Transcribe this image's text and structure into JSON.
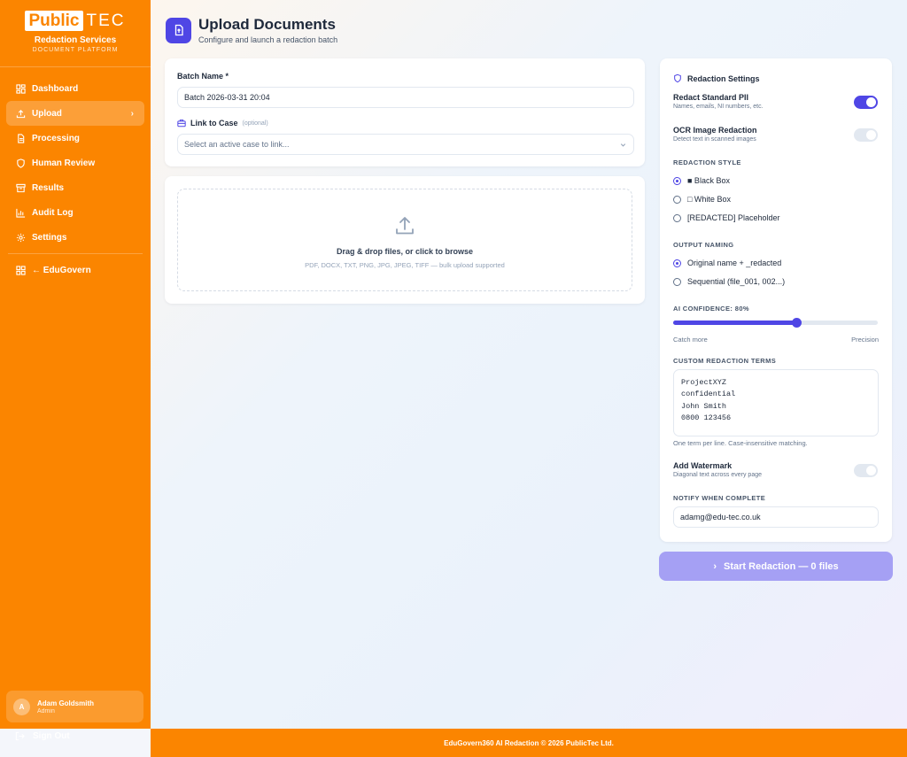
{
  "brand": {
    "logo_public": "Public",
    "logo_tec": "TEC",
    "title": "Redaction Services",
    "subtitle": "DOCUMENT PLATFORM"
  },
  "sidebar": {
    "items": [
      {
        "label": "Dashboard",
        "icon": "dashboard-icon"
      },
      {
        "label": "Upload",
        "icon": "upload-icon",
        "active": true
      },
      {
        "label": "Processing",
        "icon": "file-icon"
      },
      {
        "label": "Human Review",
        "icon": "shield-icon"
      },
      {
        "label": "Results",
        "icon": "archive-icon"
      },
      {
        "label": "Audit Log",
        "icon": "bar-chart-icon"
      },
      {
        "label": "Settings",
        "icon": "gear-icon"
      }
    ],
    "back_link": "← EduGovern",
    "user": {
      "initial": "A",
      "name": "Adam Goldsmith",
      "role": "Admin"
    },
    "sign_out": "Sign Out"
  },
  "header": {
    "title": "Upload Documents",
    "subtitle": "Configure and launch a redaction batch"
  },
  "batch": {
    "name_label": "Batch Name *",
    "name_value": "Batch 2026-03-31 20:04",
    "case_label": "Link to Case",
    "case_optional": "(optional)",
    "case_placeholder": "Select an active case to link..."
  },
  "dropzone": {
    "title": "Drag & drop files, or click to browse",
    "subtitle": "PDF, DOCX, TXT, PNG, JPG, JPEG, TIFF — bulk upload supported"
  },
  "settings": {
    "title": "Redaction Settings",
    "pii": {
      "title": "Redact Standard PII",
      "desc": "Names, emails, NI numbers, etc.",
      "on": true
    },
    "ocr": {
      "title": "OCR Image Redaction",
      "desc": "Detect text in scanned images",
      "on": false
    },
    "style_heading": "REDACTION STYLE",
    "styles": [
      {
        "label": "■ Black Box",
        "checked": true
      },
      {
        "label": "□ White Box",
        "checked": false
      },
      {
        "label": "[REDACTED] Placeholder",
        "checked": false
      }
    ],
    "naming_heading": "OUTPUT NAMING",
    "naming": [
      {
        "label": "Original name + _redacted",
        "checked": true
      },
      {
        "label": "Sequential (file_001, 002...)",
        "checked": false
      }
    ],
    "confidence_label": "AI CONFIDENCE: 80%",
    "confidence_value": 0.6,
    "confidence_min_label": "Catch more",
    "confidence_max_label": "Precision",
    "terms_heading": "CUSTOM REDACTION TERMS",
    "terms_value": "ProjectXYZ\nconfidential\nJohn Smith\n0800 123456",
    "terms_hint": "One term per line. Case-insensitive matching.",
    "watermark": {
      "title": "Add Watermark",
      "desc": "Diagonal text across every page",
      "on": false
    },
    "notify_heading": "NOTIFY WHEN COMPLETE",
    "notify_value": "adamg@edu-tec.co.uk"
  },
  "start_button": "Start Redaction — 0 files",
  "footer": "EduGovern360 AI Redaction © 2026 PublicTec Ltd.",
  "colors": {
    "brand_orange": "#fb8500",
    "accent": "#4f46e5",
    "start_button_disabled": "#a5a0f4"
  }
}
